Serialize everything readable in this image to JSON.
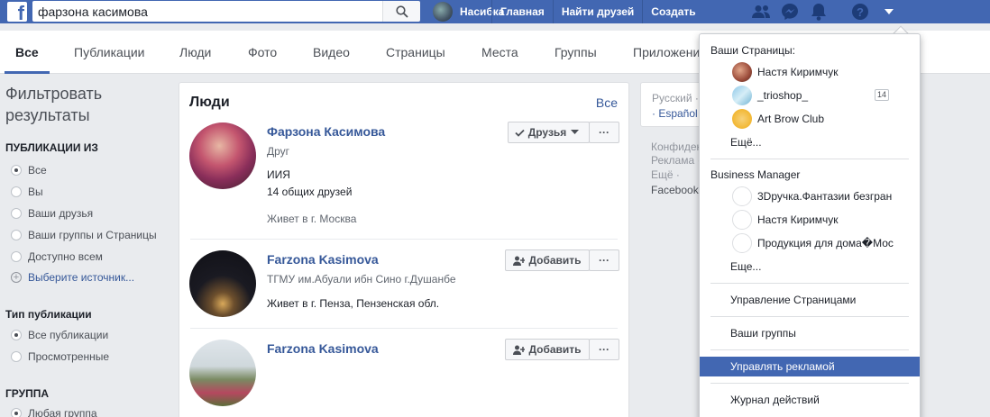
{
  "topbar": {
    "search_value": "фарзона касимова",
    "user_name": "Насибка",
    "links": [
      "Главная",
      "Найти друзей",
      "Создать"
    ],
    "icons": [
      "friends-icon",
      "messenger-icon",
      "notifications-icon",
      "help-icon",
      "menu-caret-icon"
    ],
    "bg_color": "#4267b2"
  },
  "tabs": [
    "Все",
    "Публикации",
    "Люди",
    "Фото",
    "Видео",
    "Страницы",
    "Места",
    "Группы",
    "Приложения"
  ],
  "filters": {
    "title": "Фильтровать результаты",
    "section1": {
      "heading": "ПУБЛИКАЦИИ ИЗ",
      "options": [
        "Все",
        "Вы",
        "Ваши друзья",
        "Ваши группы и Страницы",
        "Доступно всем"
      ],
      "add_source": "Выберите источник..."
    },
    "section2": {
      "heading": "Тип публикации",
      "options": [
        "Все публикации",
        "Просмотренные"
      ]
    },
    "section3": {
      "heading": "ГРУППА",
      "options": [
        "Любая группа"
      ]
    }
  },
  "people": {
    "title": "Люди",
    "see_all": "Все",
    "results": [
      {
        "name": "Фарзона Касимова",
        "line1": "Друг",
        "line2": "ИИЯ",
        "line3": "14 общих друзей",
        "line4": "Живет в г. Москва",
        "button": "Друзья"
      },
      {
        "name": "Farzona Kasimova",
        "line1": "ТГМУ им.Абуали ибн Сино г.Душанбе",
        "line2": "Живет в г. Пенза, Пензенская обл.",
        "button": "Добавить"
      },
      {
        "name": "Farzona Kasimova",
        "button": "Добавить"
      }
    ],
    "more_label": "···"
  },
  "right_column": {
    "lang1": "Русский ·",
    "lang2": "· Español",
    "footer": [
      "Конфиден",
      "Реклама ·",
      "Ещё ·",
      "Facebook"
    ]
  },
  "menu": {
    "pages_heading": "Ваши Страницы:",
    "pages": [
      "Настя Киримчук",
      "_trioshop_",
      "Art Brow Club"
    ],
    "pages_badge": "14",
    "pages_more": "Ещё...",
    "bm_heading": "Business Manager",
    "bm_items": [
      "3Dручка.Фантазии безгран",
      "Настя Киримчук",
      "Продукция для дома�Мос"
    ],
    "bm_more": "Еще...",
    "manage_pages": "Управление Страницами",
    "your_groups": "Ваши группы",
    "manage_ads": "Управлять рекламой",
    "activity_log": "Журнал действий"
  }
}
